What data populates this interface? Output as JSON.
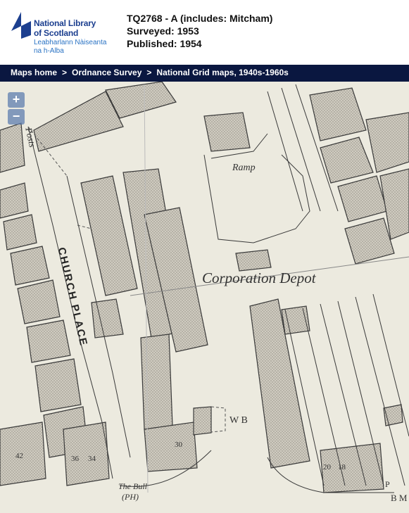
{
  "header": {
    "logo_en_line1": "National Library",
    "logo_en_line2": "of Scotland",
    "logo_gd_line1": "Leabharlann Nàiseanta",
    "logo_gd_line2": "na h-Alba",
    "sheet_title": "TQ2768 - A (includes: Mitcham)",
    "surveyed": "Surveyed: 1953",
    "published": "Published: 1954"
  },
  "breadcrumb": {
    "items": [
      "Maps home",
      "Ordnance Survey",
      "National Grid maps, 1940s-1960s"
    ],
    "separator": ">"
  },
  "zoom": {
    "in_label": "+",
    "out_label": "−"
  },
  "map_labels": {
    "corporation_depot": "Corporation Depot",
    "ramp": "Ramp",
    "street": "CHURCH PLACE",
    "posts": "Posts",
    "wb": "W B",
    "the_bull": "The Bull",
    "ph": "(PH)",
    "bm": "B M",
    "p": "P"
  },
  "house_numbers": [
    "42",
    "36",
    "34",
    "30",
    "20",
    "18"
  ],
  "colors": {
    "brand": "#1c3f8f",
    "breadcrumb_bg": "#0a1740",
    "map_paper": "#eceadf",
    "building_fill": "#c8c5ba"
  }
}
